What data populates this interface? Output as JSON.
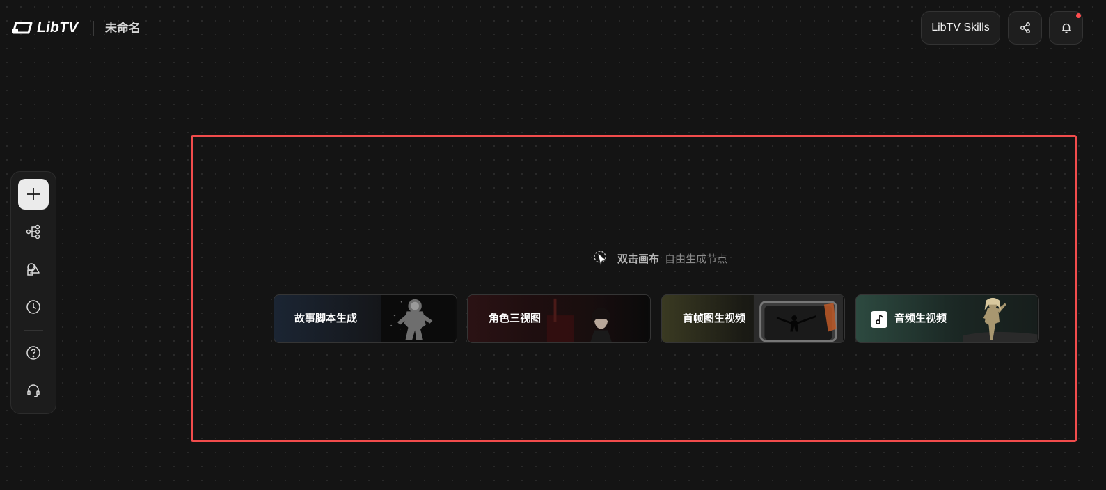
{
  "header": {
    "logo_text": "LibTV",
    "doc_title": "未命名",
    "skills_label": "LibTV Skills",
    "share_icon": "share-icon",
    "bell_icon": "bell-icon",
    "has_notification": true
  },
  "sidebar": {
    "items": [
      {
        "name": "add",
        "icon": "plus-icon",
        "active": true
      },
      {
        "name": "workflow",
        "icon": "workflow-nodes-icon",
        "active": false
      },
      {
        "name": "assets",
        "icon": "shapes-icon",
        "active": false
      },
      {
        "name": "history",
        "icon": "clock-icon",
        "active": false
      },
      {
        "name": "help",
        "icon": "question-circle-icon",
        "active": false
      },
      {
        "name": "support",
        "icon": "headset-icon",
        "active": false
      }
    ]
  },
  "canvas": {
    "hint_strong": "双击画布",
    "hint_weak": "自由生成节点",
    "hint_icon": "double-click-cursor-icon",
    "highlight_color": "#f14c4c"
  },
  "templates": [
    {
      "label": "故事脚本生成",
      "art": "astronaut-image"
    },
    {
      "label": "角色三视图",
      "art": "portrait-image"
    },
    {
      "label": "首帧图生视频",
      "art": "silhouette-frame-image"
    },
    {
      "label": "音频生视频",
      "art": "dancer-image",
      "icon": "music-note-icon"
    }
  ]
}
